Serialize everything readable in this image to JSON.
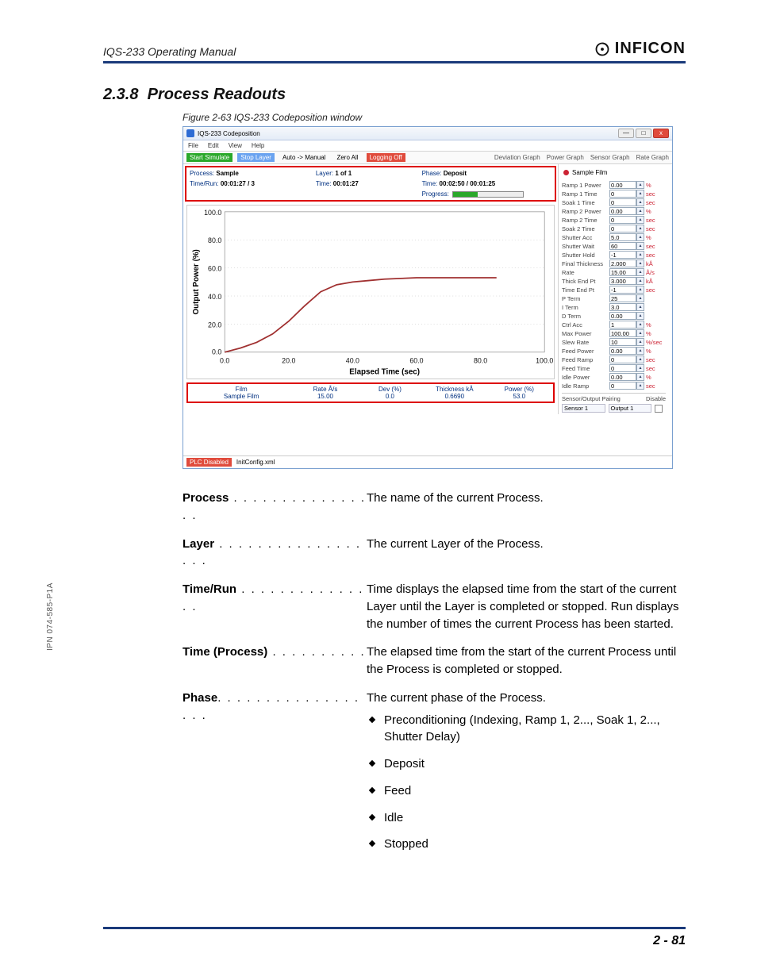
{
  "header": {
    "doc_title": "IQS-233 Operating Manual",
    "brand": "INFICON"
  },
  "side_pn": "IPN 074-585-P1A",
  "section": {
    "number": "2.3.8",
    "title": "Process Readouts"
  },
  "figure_caption": "Figure 2-63  IQS-233 Codeposition window",
  "window": {
    "title": "IQS-233 Codeposition",
    "win_buttons": {
      "min": "—",
      "max": "□",
      "close": "x"
    },
    "menu": [
      "File",
      "Edit",
      "View",
      "Help"
    ],
    "toolbar_left": {
      "start_sim": "Start Simulate",
      "stop_layer": "Stop Layer",
      "auto_manual": "Auto -> Manual",
      "zero_all": "Zero All",
      "logging": "Logging Off"
    },
    "toolbar_right": [
      "Deviation Graph",
      "Power Graph",
      "Sensor Graph",
      "Rate Graph"
    ],
    "info": {
      "k_process": "Process:",
      "v_process": "Sample",
      "k_layer": "Layer:",
      "v_layer": "1 of 1",
      "k_phase": "Phase:",
      "v_phase": "Deposit",
      "k_timerun": "Time/Run:",
      "v_timerun": "00:01:27 / 3",
      "k_time": "Time:",
      "v_time": "00:01:27",
      "k_ptime": "Time:",
      "v_ptime": "00:02:50 / 00:01:25",
      "k_progress": "Progress:"
    },
    "chart": {
      "ylabel": "Output Power (%)",
      "xlabel": "Elapsed Time (sec)",
      "yticks": [
        "100.0",
        "80.0",
        "60.0",
        "40.0",
        "20.0",
        "0.0"
      ],
      "xticks": [
        "0.0",
        "20.0",
        "40.0",
        "60.0",
        "80.0",
        "100.0"
      ]
    },
    "film_row": {
      "headers": [
        "Film",
        "Rate Å/s",
        "Dev (%)",
        "Thickness kÅ",
        "Power (%)"
      ],
      "values": [
        "Sample Film",
        "15.00",
        "0.0",
        "0.6690",
        "53.0"
      ]
    },
    "legend_label": "Sample Film",
    "params": [
      {
        "label": "Ramp 1 Power",
        "value": "0.00",
        "unit": "%"
      },
      {
        "label": "Ramp 1 Time",
        "value": "0",
        "unit": "sec"
      },
      {
        "label": "Soak 1 Time",
        "value": "0",
        "unit": "sec"
      },
      {
        "label": "Ramp 2 Power",
        "value": "0.00",
        "unit": "%"
      },
      {
        "label": "Ramp 2 Time",
        "value": "0",
        "unit": "sec"
      },
      {
        "label": "Soak 2 Time",
        "value": "0",
        "unit": "sec"
      },
      {
        "label": "Shutter Acc",
        "value": "5.0",
        "unit": "%"
      },
      {
        "label": "Shutter Wait",
        "value": "60",
        "unit": "sec"
      },
      {
        "label": "Shutter Hold",
        "value": "-1",
        "unit": "sec"
      },
      {
        "label": "Final Thickness",
        "value": "2.000",
        "unit": "kÅ"
      },
      {
        "label": "Rate",
        "value": "15.00",
        "unit": "Å/s"
      },
      {
        "label": "Thick End Pt",
        "value": "3.000",
        "unit": "kÅ"
      },
      {
        "label": "Time End Pt",
        "value": "-1",
        "unit": "sec"
      },
      {
        "label": "P Term",
        "value": "25",
        "unit": ""
      },
      {
        "label": "I Term",
        "value": "3.0",
        "unit": ""
      },
      {
        "label": "D Term",
        "value": "0.00",
        "unit": ""
      },
      {
        "label": "Ctrl Acc",
        "value": "1",
        "unit": "%"
      },
      {
        "label": "Max Power",
        "value": "100.00",
        "unit": "%"
      },
      {
        "label": "Slew Rate",
        "value": "10",
        "unit": "%/sec"
      },
      {
        "label": "Feed Power",
        "value": "0.00",
        "unit": "%"
      },
      {
        "label": "Feed Ramp",
        "value": "0",
        "unit": "sec"
      },
      {
        "label": "Feed Time",
        "value": "0",
        "unit": "sec"
      },
      {
        "label": "Idle Power",
        "value": "0.00",
        "unit": "%"
      },
      {
        "label": "Idle Ramp",
        "value": "0",
        "unit": "sec"
      }
    ],
    "pairing": {
      "header": "Sensor/Output Pairing",
      "disable": "Disable",
      "sensor": "Sensor 1",
      "output": "Output 1"
    },
    "status": {
      "plc": "PLC Disabled",
      "file": "InitConfig.xml"
    }
  },
  "definitions": [
    {
      "term": "Process",
      "dots": " . . . . . . . . . . . . . . . . ",
      "desc": "The name of the current Process."
    },
    {
      "term": "Layer",
      "dots": " . . . . . . . . . . . . . . . . . . ",
      "desc": "The current Layer of the Process."
    },
    {
      "term": "Time/Run",
      "dots": " . . . . . . . . . . . . . . . ",
      "desc": "Time displays the elapsed time from the start of the current Layer until the Layer is completed or stopped. Run displays the number of times the current Process has been started."
    },
    {
      "term": "Time (Process)",
      "dots": " . . . . . . . . . . ",
      "desc": "The elapsed time from the start of the current Process until the Process is completed or stopped."
    },
    {
      "term": "Phase",
      "dots": ". . . . . . . . . . . . . . . . . . ",
      "desc": "The current phase of the Process.",
      "bullets": [
        "Preconditioning (Indexing, Ramp 1, 2..., Soak 1, 2..., Shutter Delay)",
        "Deposit",
        "Feed",
        "Idle",
        "Stopped"
      ]
    }
  ],
  "page_number": "2 - 81",
  "chart_data": {
    "type": "line",
    "title": "",
    "xlabel": "Elapsed Time (sec)",
    "ylabel": "Output Power (%)",
    "xlim": [
      0,
      100
    ],
    "ylim": [
      0,
      100
    ],
    "series": [
      {
        "name": "Sample Film",
        "x": [
          0,
          5,
          10,
          15,
          20,
          25,
          30,
          35,
          40,
          45,
          50,
          55,
          60,
          65,
          70,
          75,
          80,
          85
        ],
        "y": [
          0,
          3,
          7,
          13,
          22,
          33,
          43,
          48,
          50,
          51,
          52,
          52.5,
          53,
          53,
          53,
          53,
          53,
          53
        ]
      }
    ]
  }
}
